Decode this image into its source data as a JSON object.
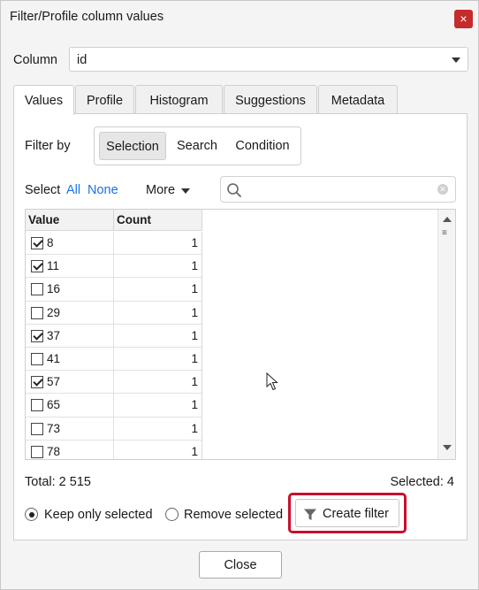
{
  "window": {
    "title": "Filter/Profile column values",
    "close_glyph": "×"
  },
  "column": {
    "label": "Column",
    "value": "id"
  },
  "tabs": [
    {
      "label": "Values",
      "active": true
    },
    {
      "label": "Profile",
      "active": false
    },
    {
      "label": "Histogram",
      "active": false
    },
    {
      "label": "Suggestions",
      "active": false
    },
    {
      "label": "Metadata",
      "active": false
    }
  ],
  "filter_by": {
    "label": "Filter by",
    "options": [
      "Selection",
      "Search",
      "Condition"
    ],
    "active": "Selection"
  },
  "select": {
    "label": "Select",
    "all": "All",
    "none": "None",
    "more": "More"
  },
  "search": {
    "placeholder": "",
    "value": ""
  },
  "table": {
    "headers": {
      "value": "Value",
      "count": "Count"
    },
    "rows": [
      {
        "value": "8",
        "count": "1",
        "checked": true
      },
      {
        "value": "11",
        "count": "1",
        "checked": true
      },
      {
        "value": "16",
        "count": "1",
        "checked": false
      },
      {
        "value": "29",
        "count": "1",
        "checked": false
      },
      {
        "value": "37",
        "count": "1",
        "checked": true
      },
      {
        "value": "41",
        "count": "1",
        "checked": false
      },
      {
        "value": "57",
        "count": "1",
        "checked": true
      },
      {
        "value": "65",
        "count": "1",
        "checked": false
      },
      {
        "value": "73",
        "count": "1",
        "checked": false
      },
      {
        "value": "78",
        "count": "1",
        "checked": false
      }
    ]
  },
  "summary": {
    "total": "Total: 2 515",
    "selected": "Selected: 4"
  },
  "mode": {
    "keep_only_selected": "Keep only selected",
    "remove_selected": "Remove selected",
    "active": "keep_only_selected"
  },
  "buttons": {
    "create_filter": "Create filter",
    "close": "Close"
  },
  "colors": {
    "accent_link": "#1a73e8",
    "highlight": "#c8102e",
    "close_button": "#c42b2b"
  },
  "icons": [
    "close-icon",
    "chevron-down-icon",
    "search-icon",
    "clear-icon",
    "funnel-icon",
    "scroll-up-icon",
    "scroll-down-icon",
    "mouse-cursor-icon"
  ]
}
